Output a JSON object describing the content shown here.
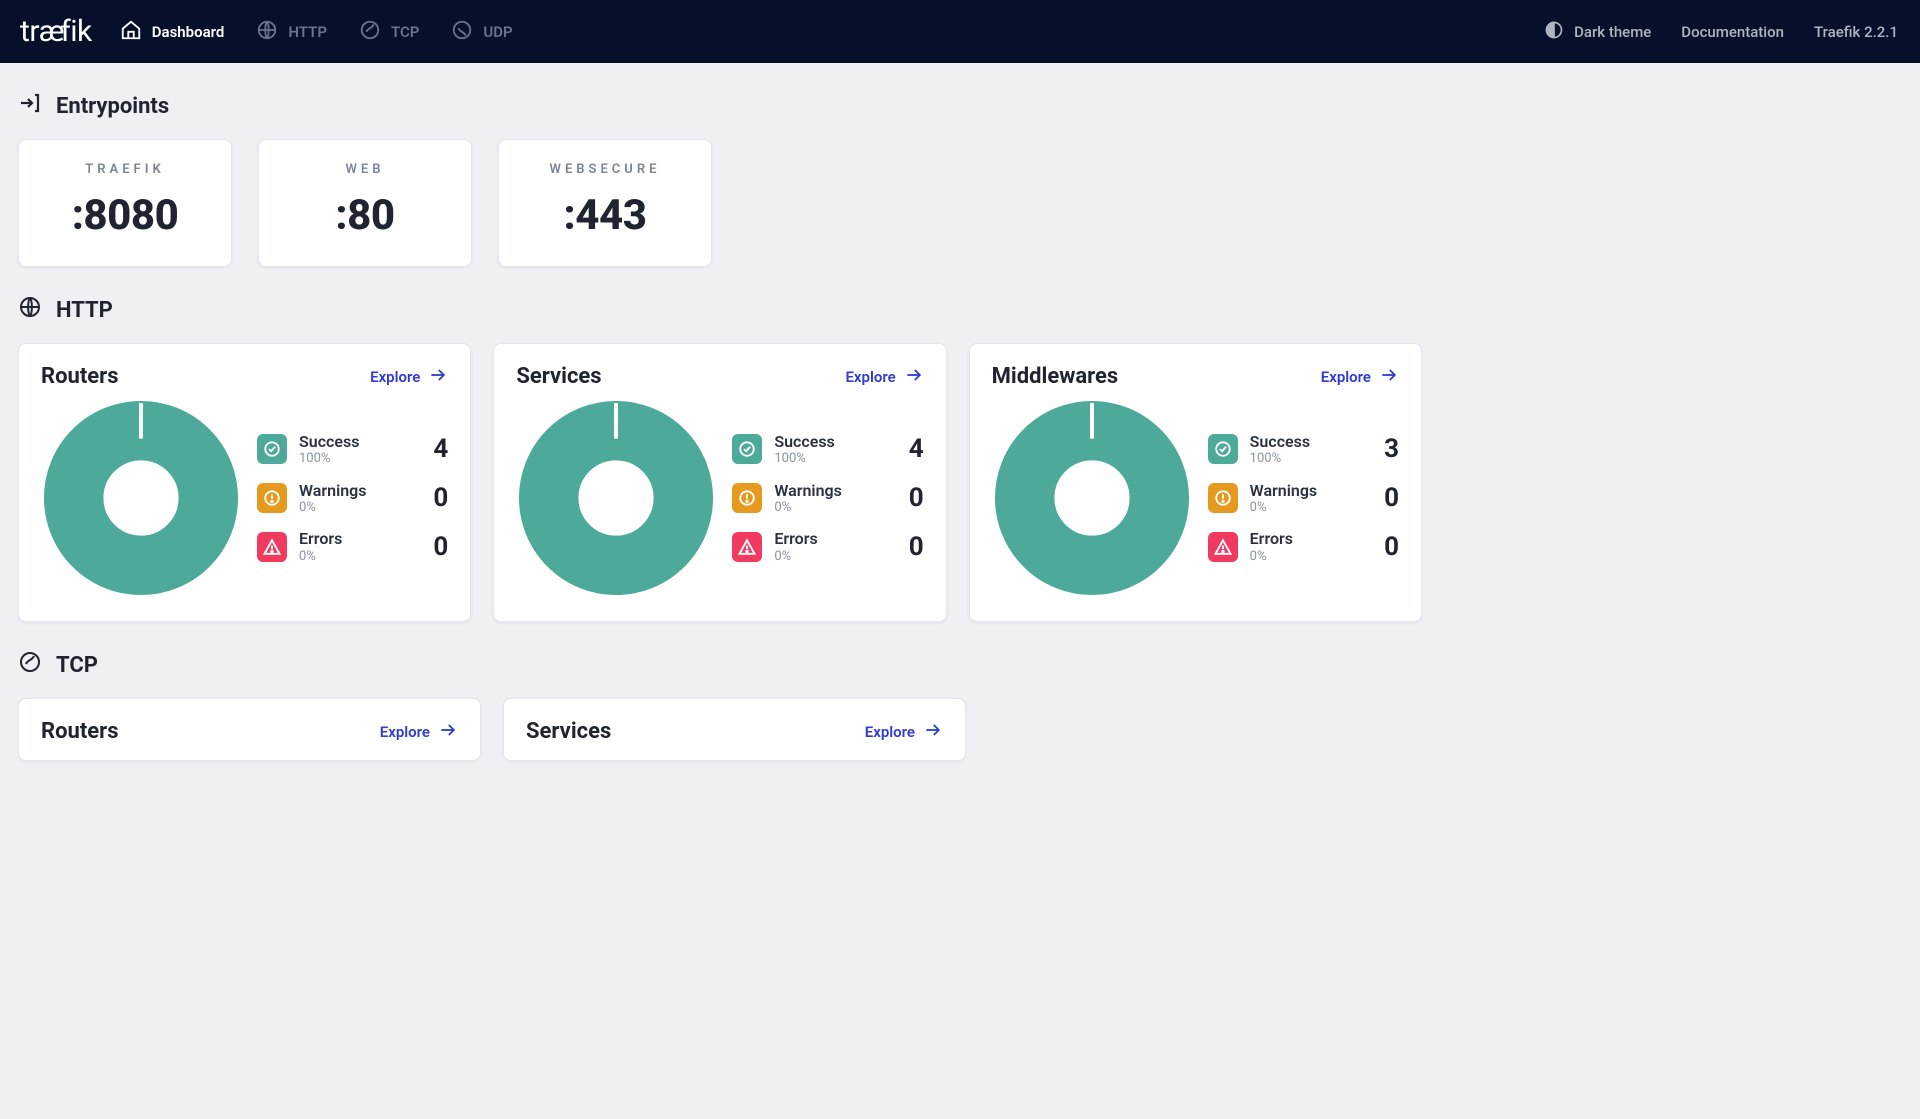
{
  "header": {
    "logo_text": "træfik",
    "nav": [
      {
        "label": "Dashboard",
        "active": true
      },
      {
        "label": "HTTP",
        "active": false
      },
      {
        "label": "TCP",
        "active": false
      },
      {
        "label": "UDP",
        "active": false
      }
    ],
    "right": {
      "theme": "Dark theme",
      "docs": "Documentation",
      "version": "Traefik 2.2.1"
    }
  },
  "sections": {
    "entrypoints": {
      "title": "Entrypoints"
    },
    "http": {
      "title": "HTTP"
    },
    "tcp": {
      "title": "TCP"
    }
  },
  "entrypoints": [
    {
      "name": "TRAEFIK",
      "port": ":8080"
    },
    {
      "name": "WEB",
      "port": ":80"
    },
    {
      "name": "WEBSECURE",
      "port": ":443"
    }
  ],
  "common": {
    "explore": "Explore",
    "success": "Success",
    "warnings": "Warnings",
    "errors": "Errors"
  },
  "http_cards": [
    {
      "title": "Routers",
      "success_pct": "100%",
      "success_n": 4,
      "warn_pct": "0%",
      "warn_n": 0,
      "err_pct": "0%",
      "err_n": 0
    },
    {
      "title": "Services",
      "success_pct": "100%",
      "success_n": 4,
      "warn_pct": "0%",
      "warn_n": 0,
      "err_pct": "0%",
      "err_n": 0
    },
    {
      "title": "Middlewares",
      "success_pct": "100%",
      "success_n": 3,
      "warn_pct": "0%",
      "warn_n": 0,
      "err_pct": "0%",
      "err_n": 0
    }
  ],
  "tcp_cards": [
    {
      "title": "Routers"
    },
    {
      "title": "Services"
    }
  ],
  "chart_data": [
    {
      "type": "pie",
      "title": "HTTP Routers",
      "series": [
        {
          "name": "Success",
          "value": 4
        },
        {
          "name": "Warnings",
          "value": 0
        },
        {
          "name": "Errors",
          "value": 0
        }
      ]
    },
    {
      "type": "pie",
      "title": "HTTP Services",
      "series": [
        {
          "name": "Success",
          "value": 4
        },
        {
          "name": "Warnings",
          "value": 0
        },
        {
          "name": "Errors",
          "value": 0
        }
      ]
    },
    {
      "type": "pie",
      "title": "HTTP Middlewares",
      "series": [
        {
          "name": "Success",
          "value": 3
        },
        {
          "name": "Warnings",
          "value": 0
        },
        {
          "name": "Errors",
          "value": 0
        }
      ]
    }
  ],
  "colors": {
    "success": "#4da999",
    "warning": "#e59a1f",
    "error": "#f03a5f",
    "accent": "#2f3bd1"
  }
}
